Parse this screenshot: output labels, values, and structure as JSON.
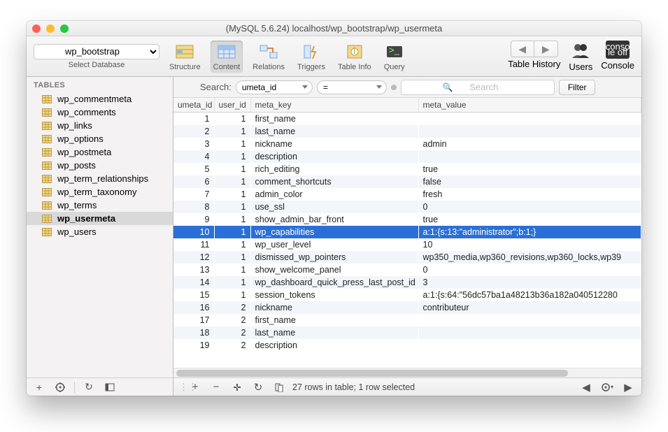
{
  "window": {
    "title": "(MySQL 5.6.24) localhost/wp_bootstrap/wp_usermeta"
  },
  "db_selector": {
    "value": "wp_bootstrap",
    "label": "Select Database"
  },
  "toolbar": {
    "structure": "Structure",
    "content": "Content",
    "relations": "Relations",
    "triggers": "Triggers",
    "tableinfo": "Table Info",
    "query": "Query",
    "history": "Table History",
    "users": "Users",
    "console": "Console"
  },
  "sidebar": {
    "header": "TABLES",
    "tables": [
      "wp_commentmeta",
      "wp_comments",
      "wp_links",
      "wp_options",
      "wp_postmeta",
      "wp_posts",
      "wp_term_relationships",
      "wp_term_taxonomy",
      "wp_terms",
      "wp_usermeta",
      "wp_users"
    ],
    "selected_index": 9
  },
  "search": {
    "label": "Search:",
    "field": "umeta_id",
    "op": "=",
    "placeholder": "Search",
    "filter": "Filter"
  },
  "columns": [
    "umeta_id",
    "user_id",
    "meta_key",
    "meta_value"
  ],
  "rows": [
    {
      "umeta_id": 1,
      "user_id": 1,
      "meta_key": "first_name",
      "meta_value": ""
    },
    {
      "umeta_id": 2,
      "user_id": 1,
      "meta_key": "last_name",
      "meta_value": ""
    },
    {
      "umeta_id": 3,
      "user_id": 1,
      "meta_key": "nickname",
      "meta_value": "admin"
    },
    {
      "umeta_id": 4,
      "user_id": 1,
      "meta_key": "description",
      "meta_value": ""
    },
    {
      "umeta_id": 5,
      "user_id": 1,
      "meta_key": "rich_editing",
      "meta_value": "true"
    },
    {
      "umeta_id": 6,
      "user_id": 1,
      "meta_key": "comment_shortcuts",
      "meta_value": "false"
    },
    {
      "umeta_id": 7,
      "user_id": 1,
      "meta_key": "admin_color",
      "meta_value": "fresh"
    },
    {
      "umeta_id": 8,
      "user_id": 1,
      "meta_key": "use_ssl",
      "meta_value": "0"
    },
    {
      "umeta_id": 9,
      "user_id": 1,
      "meta_key": "show_admin_bar_front",
      "meta_value": "true"
    },
    {
      "umeta_id": 10,
      "user_id": 1,
      "meta_key": "wp_capabilities",
      "meta_value": "a:1:{s:13:\"administrator\";b:1;}"
    },
    {
      "umeta_id": 11,
      "user_id": 1,
      "meta_key": "wp_user_level",
      "meta_value": "10"
    },
    {
      "umeta_id": 12,
      "user_id": 1,
      "meta_key": "dismissed_wp_pointers",
      "meta_value": "wp350_media,wp360_revisions,wp360_locks,wp39"
    },
    {
      "umeta_id": 13,
      "user_id": 1,
      "meta_key": "show_welcome_panel",
      "meta_value": "0"
    },
    {
      "umeta_id": 14,
      "user_id": 1,
      "meta_key": "wp_dashboard_quick_press_last_post_id",
      "meta_value": "3"
    },
    {
      "umeta_id": 15,
      "user_id": 1,
      "meta_key": "session_tokens",
      "meta_value": "a:1:{s:64:\"56dc57ba1a48213b36a182a040512280"
    },
    {
      "umeta_id": 16,
      "user_id": 2,
      "meta_key": "nickname",
      "meta_value": "contributeur"
    },
    {
      "umeta_id": 17,
      "user_id": 2,
      "meta_key": "first_name",
      "meta_value": ""
    },
    {
      "umeta_id": 18,
      "user_id": 2,
      "meta_key": "last_name",
      "meta_value": ""
    },
    {
      "umeta_id": 19,
      "user_id": 2,
      "meta_key": "description",
      "meta_value": ""
    }
  ],
  "selected_row": 9,
  "status": "27 rows in table; 1 row selected",
  "console_badge": {
    "l1": "conso",
    "l2": "le off"
  }
}
